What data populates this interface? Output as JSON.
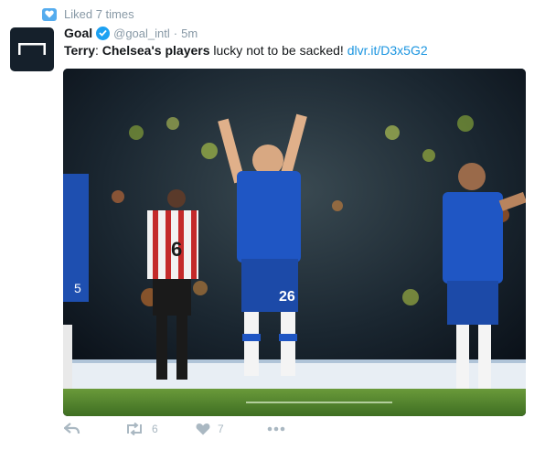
{
  "context": {
    "label": "Liked 7 times",
    "icon": "like-notification-icon"
  },
  "tweet": {
    "name": "Goal",
    "handle": "@goal_intl",
    "separator": "·",
    "time": "5m",
    "text_bold_1": "Terry",
    "text_sep": ": ",
    "text_bold_2": "Chelsea's players",
    "text_rest": " lucky not to be sacked! ",
    "link": "dlvr.it/D3x5G2",
    "jersey_left": "5",
    "jersey_center": "26",
    "jersey_away": "6"
  },
  "actions": {
    "retweets": "6",
    "likes": "7"
  },
  "colors": {
    "accent": "#1da1f2",
    "link": "#1b95e0",
    "muted": "#8899a6",
    "action_icon": "#aab8c2"
  }
}
